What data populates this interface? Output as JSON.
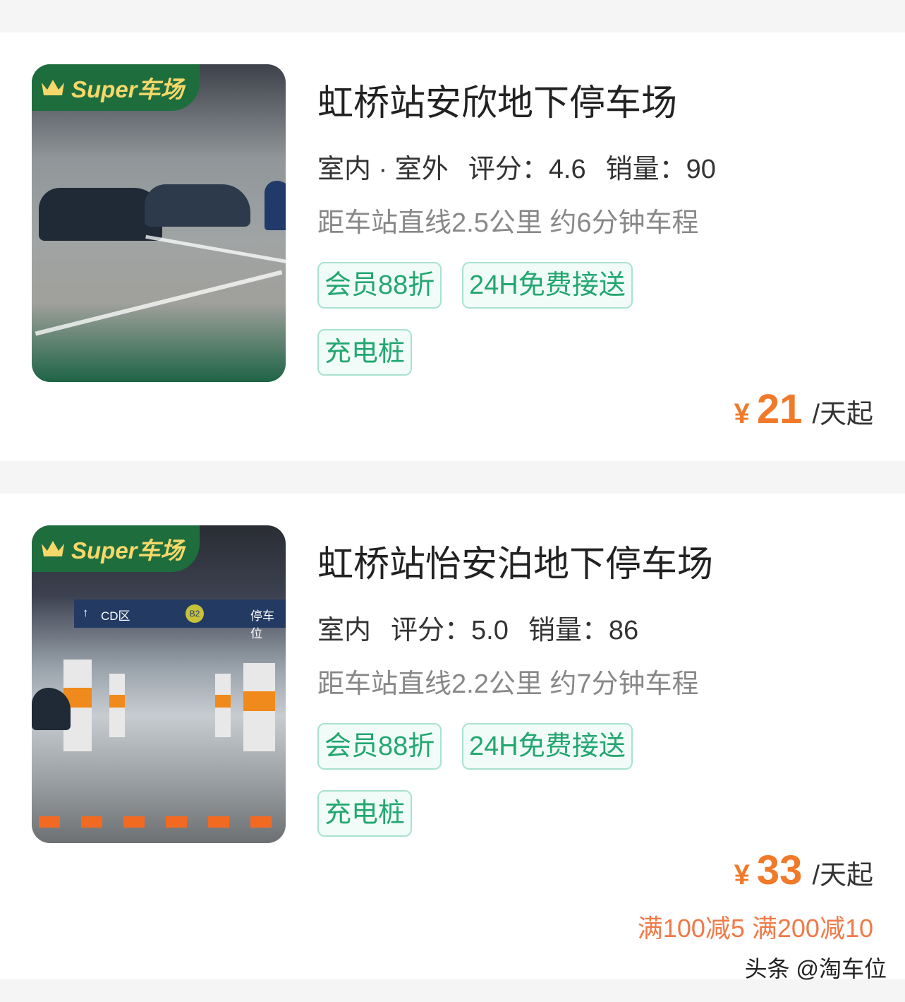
{
  "badge_text": "Super车场",
  "listings": [
    {
      "name": "虹桥站安欣地下停车场",
      "env": "室内 · 室外",
      "rating_label": "评分：",
      "rating": "4.6",
      "sales_label": "销量：",
      "sales": "90",
      "distance": "距车站直线2.5公里 约6分钟车程",
      "tags": [
        "会员88折",
        "24H免费接送",
        "充电桩"
      ],
      "currency": "¥",
      "price": "21",
      "price_unit": "/天起"
    },
    {
      "name": "虹桥站怡安泊地下停车场",
      "env": "室内",
      "rating_label": "评分：",
      "rating": "5.0",
      "sales_label": "销量：",
      "sales": "86",
      "distance": "距车站直线2.2公里 约7分钟车程",
      "tags": [
        "会员88折",
        "24H免费接送",
        "充电桩"
      ],
      "currency": "¥",
      "price": "33",
      "price_unit": "/天起",
      "promo": "满100减5 满200减10",
      "photo_sign": {
        "zone": "CD区",
        "level": "B2",
        "right": "停车位"
      }
    }
  ],
  "watermark": "头条 @淘车位",
  "colors": {
    "accent_green": "#22a771",
    "price_orange": "#f07a2a",
    "badge_green": "#1e6e3d",
    "badge_gold": "#f6d86a"
  }
}
